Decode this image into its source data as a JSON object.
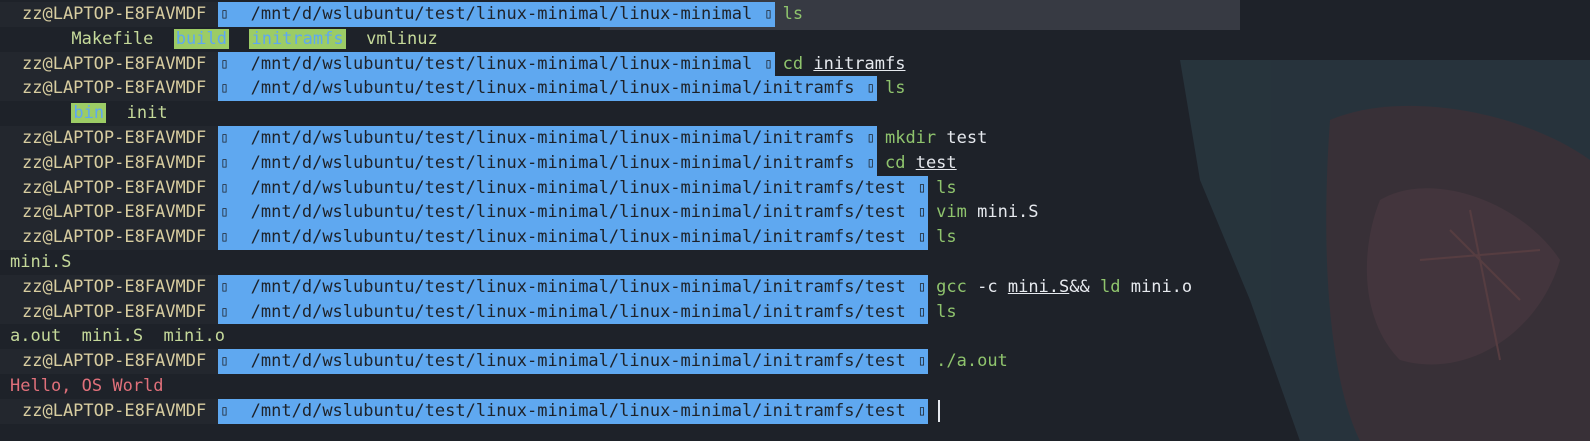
{
  "prompt_user": "zz@LAPTOP-E8FAVMDF",
  "separator_glyph": "▯",
  "paths": {
    "root": "/mnt/d/wslubuntu/test/linux-minimal/linux-minimal",
    "initramfs": "/mnt/d/wslubuntu/test/linux-minimal/linux-minimal/initramfs",
    "test": "/mnt/d/wslubuntu/test/linux-minimal/linux-minimal/initramfs/test"
  },
  "commands": {
    "ls": "ls",
    "cd": "cd",
    "mkdir": "mkdir",
    "vim": "vim",
    "gcc": "gcc",
    "ld": "ld",
    "run": "./a.out"
  },
  "args": {
    "initramfs": "initramfs",
    "test": "test",
    "mini_s": "mini.S",
    "flag_c": "-c",
    "and": "&&",
    "mini_o": "mini.o"
  },
  "outputs": {
    "ls1": [
      "Makefile",
      "build",
      "initramfs",
      "vmlinuz"
    ],
    "ls2": [
      "bin",
      "init"
    ],
    "ls3": "mini.S",
    "ls4": "a.out  mini.S  mini.o",
    "hello": "Hello, OS World"
  },
  "colors": {
    "background": "#1e2229",
    "path_bg": "#5fa8f0",
    "user_fg": "#d8cda0",
    "command_fg": "#8fc46d",
    "hello_fg": "#e0707a"
  }
}
